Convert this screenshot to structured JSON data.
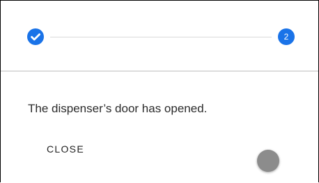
{
  "stepper": {
    "steps": [
      {
        "state": "completed",
        "icon": "check-circle-icon",
        "label": ""
      },
      {
        "state": "active",
        "number": "2"
      }
    ],
    "accent_color": "#1a73e8"
  },
  "dialog": {
    "message": "The dispenser’s door has opened.",
    "close_label": "CLOSE"
  },
  "indicator": {
    "icon": "touch-indicator",
    "color": "#8c8c8c"
  }
}
